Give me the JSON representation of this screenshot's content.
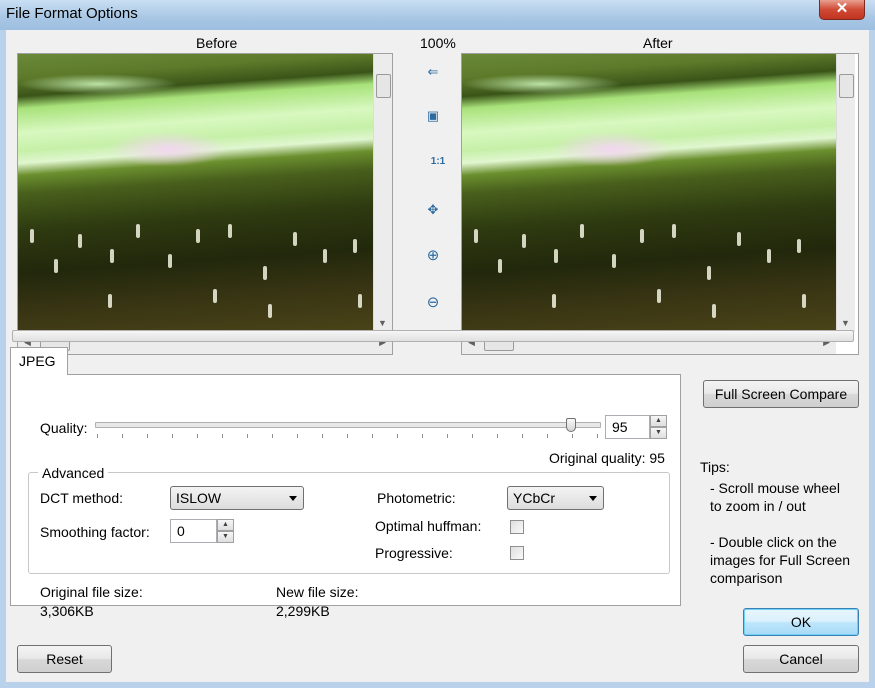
{
  "window": {
    "title": "File Format Options",
    "close_glyph": "✕"
  },
  "preview": {
    "before_label": "Before",
    "after_label": "After",
    "zoom": "100%",
    "tools": [
      {
        "name": "sync-arrow-icon",
        "glyph": "⇐"
      },
      {
        "name": "fit-window-icon",
        "glyph": "▣"
      },
      {
        "name": "actual-size-icon",
        "glyph": "1:1"
      },
      {
        "name": "fit-image-icon",
        "glyph": "✥"
      },
      {
        "name": "zoom-in-icon",
        "glyph": "⊕"
      },
      {
        "name": "zoom-out-icon",
        "glyph": "⊖"
      }
    ]
  },
  "tabs": [
    {
      "label": "JPEG"
    }
  ],
  "jpeg": {
    "quality_label": "Quality:",
    "quality_value": "95",
    "quality_fraction": 0.95,
    "original_quality": "Original quality: 95",
    "advanced_label": "Advanced",
    "dct_label": "DCT method:",
    "dct_value": "ISLOW",
    "smoothing_label": "Smoothing factor:",
    "smoothing_value": "0",
    "photometric_label": "Photometric:",
    "photometric_value": "YCbCr",
    "huffman_label": "Optimal huffman:",
    "progressive_label": "Progressive:",
    "original_size_label": "Original file size:",
    "original_size_value": "3,306KB",
    "new_size_label": "New file size:",
    "new_size_value": "2,299KB"
  },
  "buttons": {
    "full_screen": "Full Screen Compare",
    "ok": "OK",
    "cancel": "Cancel",
    "reset": "Reset"
  },
  "tips": {
    "title": "Tips:",
    "line1": "- Scroll mouse wheel",
    "line2": "to zoom in / out",
    "line3": "- Double click on the",
    "line4": "images for Full Screen",
    "line5": "comparison"
  },
  "colors": {
    "title_bar": "#a8c6e4",
    "close_button": "#c0341f",
    "default_button": "#3c7fb1"
  }
}
